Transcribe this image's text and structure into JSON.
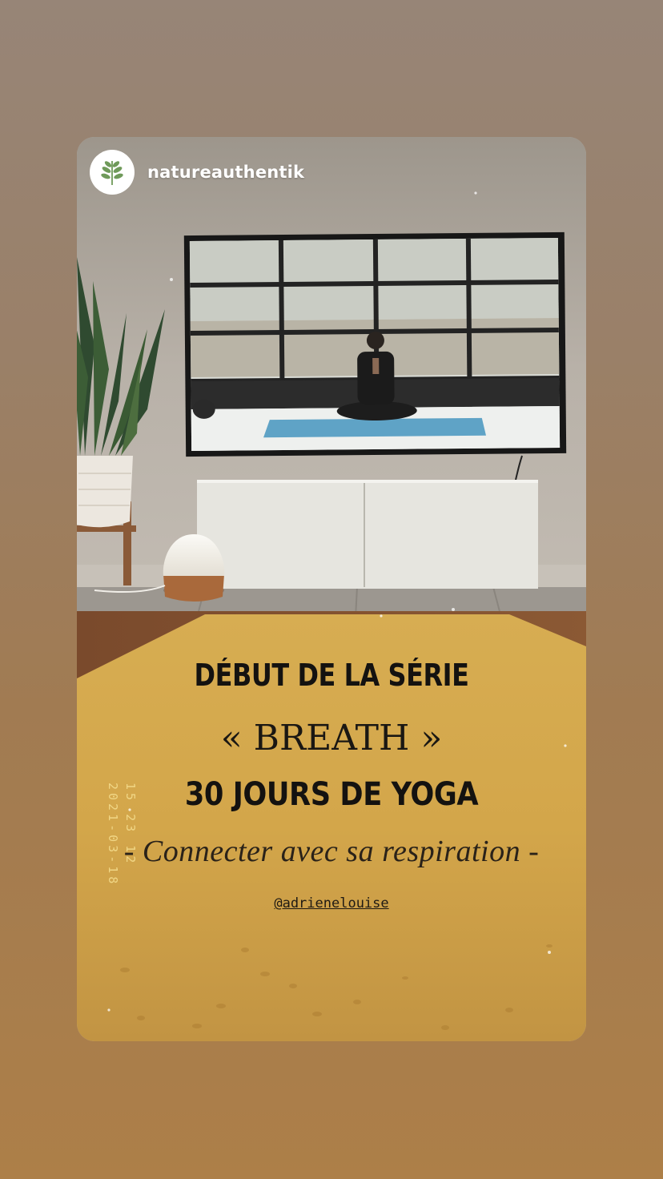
{
  "story": {
    "username": "natureauthentik",
    "avatar_icon": "leaf-branch-icon",
    "headline_1": "DÉBUT DE LA SÉRIE",
    "headline_2": "« BREATH »",
    "headline_3": "30 JOURS DE YOGA",
    "headline_4": "- Connecter avec sa respiration -",
    "mention": "@adrienelouise",
    "stamp_time": "15 23 12",
    "stamp_date": "2021-03-18"
  },
  "colors": {
    "page_background_top": "#978577",
    "page_background_bottom": "#ad7f48",
    "mat": "#d6ab4f",
    "wall": "#b7b0a7",
    "avatar_leaf": "#6f9a5a",
    "stamp": "#f4dc8c"
  }
}
